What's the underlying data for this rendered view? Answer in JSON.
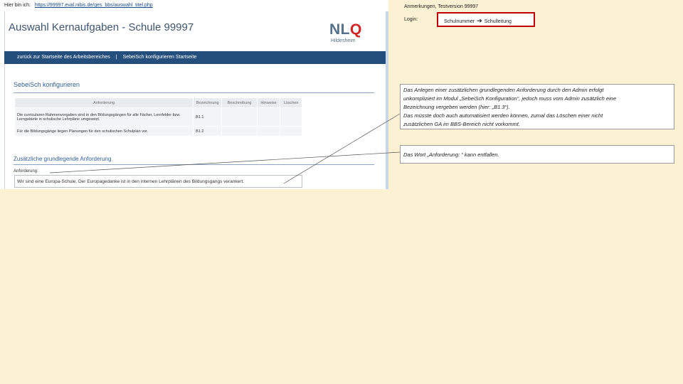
{
  "top": {
    "label": "Hier bin ich:",
    "url": "https://99997.eval.nibis.de/ges_bbs/auswahl_titel.php"
  },
  "screenshot": {
    "title": "Auswahl Kernaufgaben - Schule  99997",
    "logo": {
      "main": "NL",
      "accent": "Q",
      "sub": "Hildesheim"
    },
    "nav": {
      "back": "zurück zur Startseite des Arbeitsbereiches",
      "separator": "|",
      "config": "SebeiSch konfigurieren Startseite"
    },
    "section_heading": "SebeiSch konfigurieren",
    "table": {
      "headers": [
        "Anforderung",
        "Bezeichnung",
        "Beschreibung",
        "Hinweise",
        "Löschen"
      ],
      "rows": [
        [
          "Die curricularen Rahmenvorgaben sind in den Bildungsgängen für alle Fächer, Lernfelder bzw. Lerngebiete in schulische Lehrpläne umgesetzt.",
          "B1.1",
          "",
          "",
          ""
        ],
        [
          "Für die Bildungsgänge liegen Planungen für den schulischen Schulplan vor.",
          "B1.2",
          "",
          "",
          ""
        ]
      ]
    },
    "sub_heading": "Zusätzliche grundlegende Anforderung",
    "field_label": "Anforderung:",
    "field_value": "Wir sind eine Europa-Schule. Der Europagedanke ist in den internen Lehrplänen des Bildungsgangs verankert."
  },
  "annotations": {
    "title": "Anmerkungen, Testversion 99997",
    "login_label": "Login:",
    "login_from": "Schulnummer",
    "login_arrow": "➔",
    "login_to": "Schulleitung",
    "note1_lines": [
      "Das Anlegen einer zusätzlichen grundlegenden Anforderung durch den Admin erfolgt",
      "unkompliziert im Modul „SebeiSch Konfiguration“, jedoch muss vom Admin zusätzlich eine",
      "Bezeichnung vergeben werden (hier: „B1.3“).",
      "Das müsste doch auch automatisiert werden können, zumal das Löschen einer nicht",
      "zusätzlichen GA im BBS-Bereich nicht vorkommt."
    ],
    "note2": "Das Wort „Anforderung: “ kann entfallen."
  },
  "colors": {
    "page_bg": "#fdf1d3",
    "nav_bg": "#244f7c",
    "heading": "#2f5f93",
    "logo_accent": "#d32222",
    "login_border": "#c00000"
  }
}
